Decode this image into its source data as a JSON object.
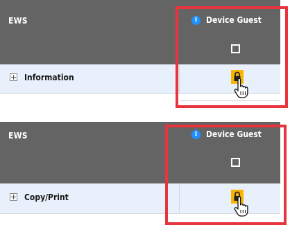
{
  "panels": [
    {
      "header": {
        "ews_label": "EWS",
        "column_label": "Device Guest"
      },
      "row": {
        "label": "Information"
      }
    },
    {
      "header": {
        "ews_label": "EWS",
        "column_label": "Device Guest"
      },
      "row": {
        "label": "Copy/Print"
      }
    }
  ],
  "icons": {
    "info": "info-icon",
    "expand": "plus-icon",
    "lock": "lock-icon",
    "cursor": "hand-pointer-cursor"
  },
  "colors": {
    "header_bg": "#646464",
    "row_bg": "#e7f0fb",
    "highlight_border": "#e8353d",
    "lock_bg": "#f7b500",
    "info_blue": "#1e90ff"
  }
}
